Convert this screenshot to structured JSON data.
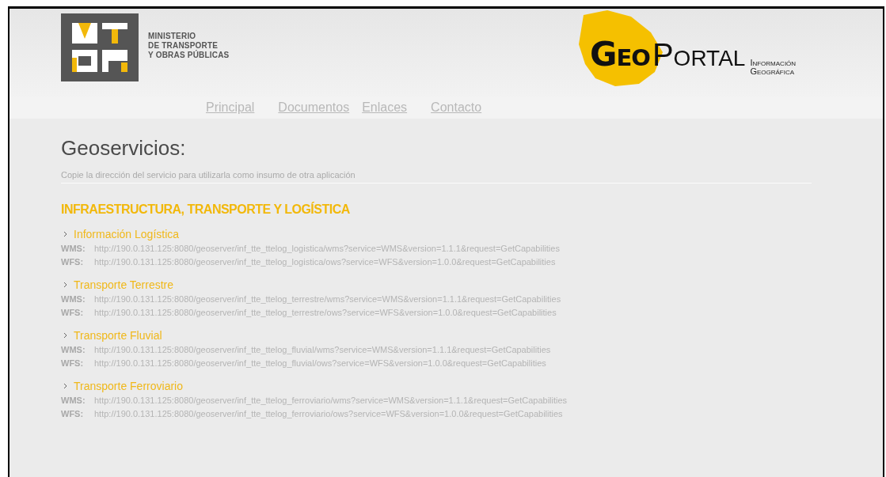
{
  "header": {
    "ministry_name": [
      "MINISTERIO",
      "DE TRANSPORTE",
      "Y OBRAS PÚBLICAS"
    ],
    "portal_name_bold": "Geo",
    "portal_name": "Portal",
    "portal_tagline": [
      "Información",
      "Geográfica"
    ]
  },
  "nav": [
    "Principal",
    "Documentos",
    "Enlaces",
    "Contacto"
  ],
  "title": "Geoservicios:",
  "subtitle": "Copie la dirección del servicio para utilizarla como insumo de otra aplicación",
  "section_title": "INFRAESTRUCTURA, TRANSPORTE Y LOGÍSTICA",
  "groups": [
    {
      "name": "Información Logística",
      "services": [
        {
          "type": "WMS:",
          "url": "http://190.0.131.125:8080/geoserver/inf_tte_ttelog_logistica/wms?service=WMS&version=1.1.1&request=GetCapabilities"
        },
        {
          "type": "WFS:",
          "url": "http://190.0.131.125:8080/geoserver/inf_tte_ttelog_logistica/ows?service=WFS&version=1.0.0&request=GetCapabilities"
        }
      ]
    },
    {
      "name": "Transporte Terrestre",
      "services": [
        {
          "type": "WMS:",
          "url": "http://190.0.131.125:8080/geoserver/inf_tte_ttelog_terrestre/wms?service=WMS&version=1.1.1&request=GetCapabilities"
        },
        {
          "type": "WFS:",
          "url": "http://190.0.131.125:8080/geoserver/inf_tte_ttelog_terrestre/ows?service=WFS&version=1.0.0&request=GetCapabilities"
        }
      ]
    },
    {
      "name": "Transporte Fluvial",
      "services": [
        {
          "type": "WMS:",
          "url": "http://190.0.131.125:8080/geoserver/inf_tte_ttelog_fluvial/wms?service=WMS&version=1.1.1&request=GetCapabilities"
        },
        {
          "type": "WFS:",
          "url": "http://190.0.131.125:8080/geoserver/inf_tte_ttelog_fluvial/ows?service=WFS&version=1.0.0&request=GetCapabilities"
        }
      ]
    },
    {
      "name": "Transporte Ferroviario",
      "services": [
        {
          "type": "WMS:",
          "url": "http://190.0.131.125:8080/geoserver/inf_tte_ttelog_ferroviario/wms?service=WMS&version=1.1.1&request=GetCapabilities"
        },
        {
          "type": "WFS:",
          "url": "http://190.0.131.125:8080/geoserver/inf_tte_ttelog_ferroviario/ows?service=WFS&version=1.0.0&request=GetCapabilities"
        }
      ]
    }
  ]
}
